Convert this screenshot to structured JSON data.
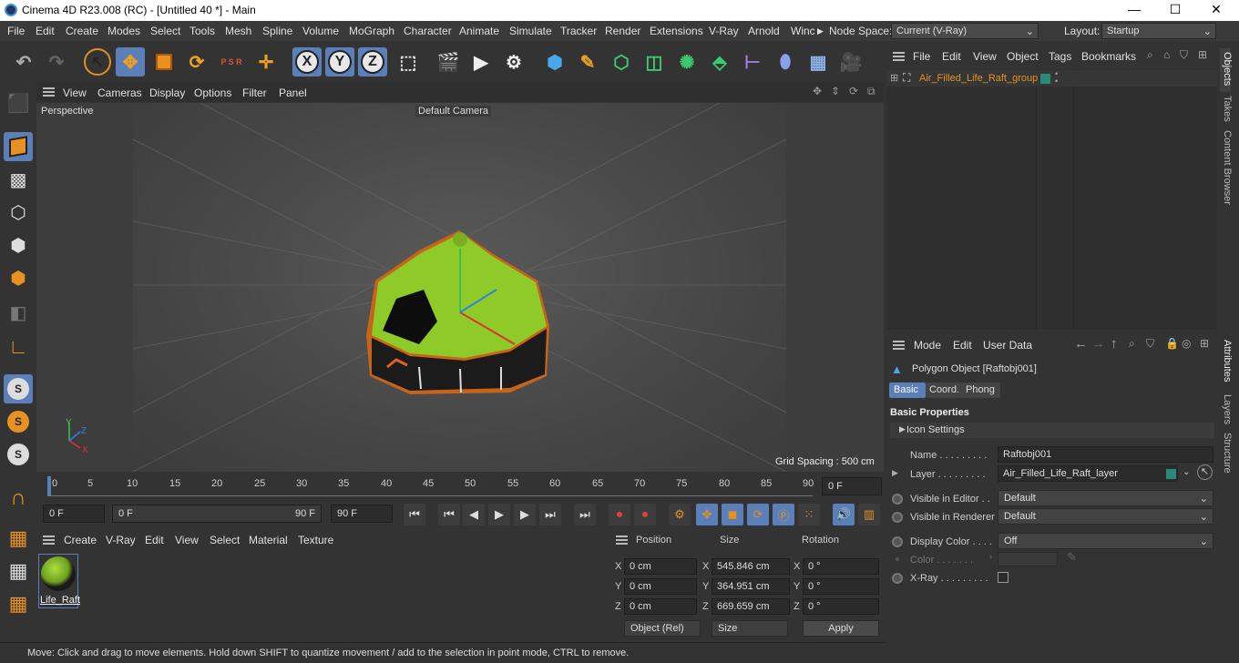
{
  "titlebar": {
    "title": "Cinema 4D R23.008 (RC) - [Untitled 40 *] - Main",
    "minimize": "—",
    "maximize": "☐",
    "close": "✕"
  },
  "menu": {
    "items": [
      "File",
      "Edit",
      "Create",
      "Modes",
      "Select",
      "Tools",
      "Mesh",
      "Spline",
      "Volume",
      "MoGraph",
      "Character",
      "Animate",
      "Simulate",
      "Tracker",
      "Render",
      "Extensions",
      "V-Ray",
      "Arnold",
      "Winc"
    ],
    "node_space_label": "Node Space:",
    "node_space_value": "Current (V-Ray)",
    "layout_label": "Layout:",
    "layout_value": "Startup"
  },
  "toolbar": {
    "x_label": "X",
    "y_label": "Y",
    "z_label": "Z",
    "psr": "P S R"
  },
  "viewport": {
    "menu": [
      "View",
      "Cameras",
      "Display",
      "Options",
      "Filter",
      "Panel"
    ],
    "view_name": "Perspective",
    "camera": "Default Camera",
    "grid_spacing": "Grid Spacing : 500 cm",
    "axis_x": "X",
    "axis_y": "Y",
    "axis_z": "Z"
  },
  "timeline": {
    "ticks": [
      "0",
      "5",
      "10",
      "15",
      "20",
      "25",
      "30",
      "35",
      "40",
      "45",
      "50",
      "55",
      "60",
      "65",
      "70",
      "75",
      "80",
      "85",
      "90"
    ],
    "current_frame": "0 F"
  },
  "playback": {
    "start": "0 F",
    "range_start": "0 F",
    "range_end": "90 F",
    "end": "90 F"
  },
  "materials": {
    "menu": [
      "Create",
      "V-Ray",
      "Edit",
      "View",
      "Select",
      "Material",
      "Texture"
    ],
    "item_label": "Life_Raft"
  },
  "coords": {
    "headers": [
      "Position",
      "Size",
      "Rotation"
    ],
    "rows": [
      {
        "axis": "X",
        "pos": "0 cm",
        "size_axis": "X",
        "size": "545.846 cm",
        "rot_axis": "X",
        "rot": "0 °"
      },
      {
        "axis": "Y",
        "pos": "0 cm",
        "size_axis": "Y",
        "size": "364.951 cm",
        "rot_axis": "Y",
        "rot": "0 °"
      },
      {
        "axis": "Z",
        "pos": "0 cm",
        "size_axis": "Z",
        "size": "669.659 cm",
        "rot_axis": "Z",
        "rot": "0 °"
      }
    ],
    "mode": "Object (Rel)",
    "size_mode": "Size",
    "apply": "Apply"
  },
  "status": "Move: Click and drag to move elements. Hold down SHIFT to quantize movement / add to the selection in point mode, CTRL to remove.",
  "objects": {
    "menu": [
      "File",
      "Edit",
      "View",
      "Object",
      "Tags",
      "Bookmarks"
    ],
    "item": "Air_Filled_Life_Raft_group"
  },
  "attributes": {
    "menu": [
      "Mode",
      "Edit",
      "User Data"
    ],
    "object": "Polygon Object [Raftobj001]",
    "tabs": [
      "Basic",
      "Coord.",
      "Phong"
    ],
    "section": "Basic Properties",
    "icon_settings": "Icon Settings",
    "name_label": "Name . . . . . . . . .",
    "name_value": "Raftobj001",
    "layer_label": "Layer . . . . . . . . .",
    "layer_value": "Air_Filled_Life_Raft_layer",
    "vis_editor_label": "Visible in Editor . .",
    "vis_editor_value": "Default",
    "vis_render_label": "Visible in Renderer",
    "vis_render_value": "Default",
    "display_color_label": "Display Color . . . .",
    "display_color_value": "Off",
    "color_label": "Color . . . . . . .",
    "xray_label": "X-Ray . . . . . . . . ."
  },
  "sidetabs": [
    "Objects",
    "Takes",
    "Content Browser",
    "Attributes",
    "Layers",
    "Structure"
  ]
}
